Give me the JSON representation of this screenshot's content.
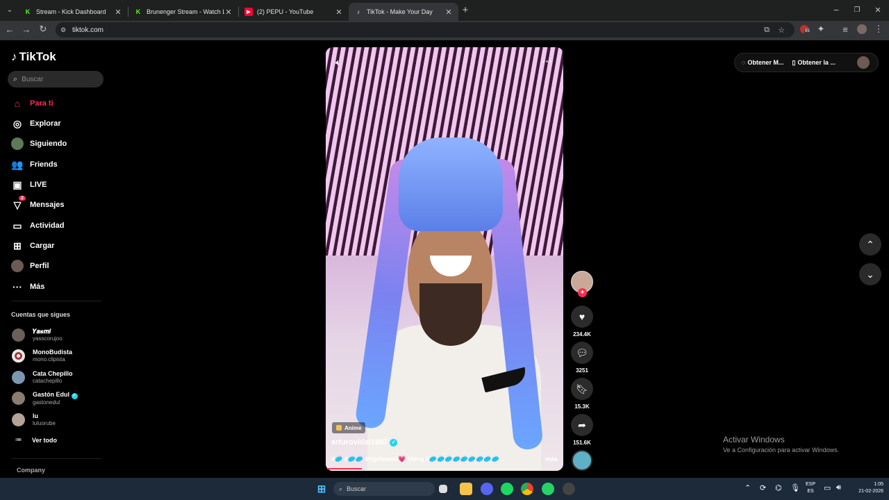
{
  "browser": {
    "tabs": [
      {
        "title": "Stream - Kick Dashboard",
        "favicon": "K",
        "color": "#53fc18",
        "active": false
      },
      {
        "title": "Brunenger Stream - Watch Live",
        "favicon": "K",
        "color": "#53fc18",
        "active": false
      },
      {
        "title": "(2) PEPU - YouTube",
        "favicon": "▶",
        "color": "#ff0033",
        "active": false
      },
      {
        "title": "TikTok - Make Your Day",
        "favicon": "♪",
        "color": "#ffffff",
        "active": true
      }
    ],
    "url": "tiktok.com",
    "extension_badge": "65"
  },
  "tiktok": {
    "logo": "TikTok",
    "search_placeholder": "Buscar",
    "nav": [
      {
        "label": "Para ti",
        "icon": "home-icon",
        "active": true
      },
      {
        "label": "Explorar",
        "icon": "compass-icon"
      },
      {
        "label": "Siguiendo",
        "icon": "avatar-icon"
      },
      {
        "label": "Friends",
        "icon": "friends-icon"
      },
      {
        "label": "LIVE",
        "icon": "live-icon"
      },
      {
        "label": "Mensajes",
        "icon": "messages-icon",
        "badge": "2"
      },
      {
        "label": "Actividad",
        "icon": "activity-icon"
      },
      {
        "label": "Cargar",
        "icon": "upload-icon"
      },
      {
        "label": "Perfil",
        "icon": "profile-icon"
      },
      {
        "label": "Más",
        "icon": "more-icon"
      }
    ],
    "following_title": "Cuentas que sigues",
    "following": [
      {
        "name": "𝒀𝒂𝒔𝒎𝒊",
        "handle": "yasscorujoo",
        "verified": false
      },
      {
        "name": "MonoBudista",
        "handle": "mono.clipista",
        "verified": false
      },
      {
        "name": "Cata Chepillo",
        "handle": "catachepillo",
        "verified": false
      },
      {
        "name": "Gastón Edul",
        "handle": "gastonedul",
        "verified": true
      },
      {
        "name": "lu",
        "handle": "luluorube",
        "verified": false
      }
    ],
    "see_all": "Ver todo",
    "company": "Company",
    "top_right": {
      "get_app1": "Obtener M...",
      "get_app2": "Obtener la ..."
    },
    "video": {
      "effect_label": "Anime",
      "author": "arturovidal1987",
      "caption_start": "#🥏 #🥏🥏 #hijoteamo💗 #king #🥏🥏🥏🥏🥏🥏🥏🥏🥏...",
      "more": "más",
      "likes": "234.4K",
      "comments": "3251",
      "saves": "15.3K",
      "shares": "151.6K"
    }
  },
  "windows": {
    "activate_title": "Activar Windows",
    "activate_sub": "Ve a Configuración para activar Windows.",
    "taskbar_search": "Buscar",
    "lang1": "ESP",
    "lang2": "ES",
    "time": "1:05",
    "date": "21-02-2026"
  },
  "colors": {
    "accent": "#fe2c55",
    "verified": "#20d5ec"
  }
}
